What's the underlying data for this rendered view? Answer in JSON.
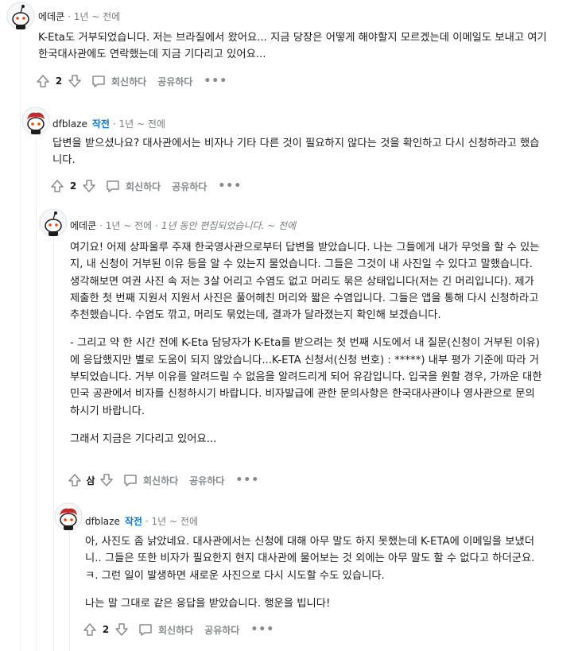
{
  "colors": {
    "op": "#0079d3",
    "meta": "#787c7e",
    "text": "#1c1c1c",
    "action": "#878a8c"
  },
  "labels": {
    "reply": "회신하다",
    "share": "공유하다",
    "more": "•••",
    "op": "작전"
  },
  "comments": [
    {
      "user": "에데쿤",
      "meta": "· 1년 ~ 전에",
      "edited": "",
      "paragraphs": [
        "K-Eta도 거부되었습니다. 저는 브라질에서 왔어요... 지금 당장은 어떻게 해야할지 모르겠는데 이메일도 보내고 여기 한국대사관에도 연락했는데 지금 기다리고 있어요..."
      ],
      "score": "2"
    },
    {
      "user": "dfblaze",
      "meta": "· 1년 ~ 전에",
      "edited": "",
      "paragraphs": [
        "답변을 받으셨나요? 대사관에서는 비자나 기타 다른 것이 필요하지 않다는 것을 확인하고 다시 신청하라고 했습니다."
      ],
      "score": "2"
    },
    {
      "user": "에데쿤",
      "meta": "· 1년 ~ 전에 ·",
      "edited": "1년 동안 편집되었습니다. ~ 전에",
      "paragraphs": [
        "여기요! 어제 상파울루 주재 한국영사관으로부터 답변을 받았습니다. 나는 그들에게 내가 무엇을 할 수 있는지, 내 신청이 거부된 이유 등을 알 수 있는지 물었습니다. 그들은 그것이 내 사진일 수 있다고 말했습니다. 생각해보면 여권 사진 속 저는 3살 어리고 수염도 없고 머리도 묶은 상태입니다(저는 긴 머리입니다). 제가 제출한 첫 번째 지원서 지원서 사진은 풀어헤친 머리와 짧은 수염입니다. 그들은 앱을 통해 다시 신청하라고 추천했습니다. 수염도 깎고, 머리도 묶었는데, 결과가 달라졌는지 확인해 보겠습니다.",
        "- 그리고 약 한 시간 전에 K-Eta 담당자가 K-Eta를 받으려는 첫 번째 시도에서 내 질문(신청이 거부된 이유)에 응답했지만 별로 도움이 되지 않았습니다...K-ETA 신청서(신청 번호) : *****) 내부 평가 기준에 따라 거부되었습니다. 거부 이유를 알려드릴 수 없음을 알려드리게 되어 유감입니다. 입국을 원할 경우, 가까운 대한민국 공관에서 비자를 신청하시기 바랍니다. 비자발급에 관한 문의사항은 한국대사관이나 영사관으로 문의하시기 바랍니다.",
        "그래서 지금은 기다리고 있어요..."
      ],
      "score": "삼"
    },
    {
      "user": "dfblaze",
      "meta": "· 1년 ~ 전에",
      "edited": "",
      "paragraphs": [
        "아, 사진도 좀 낡았네요. 대사관에서는 신청에 대해 아무 말도 하지 못했는데 K-ETA에 이메일을 보냈더니.. 그들은 또한 비자가 필요한지 현지 대사관에 물어보는 것 외에는 아무 말도 할 수 없다고 하더군요. ㅋ. 그런 일이 발생하면 새로운 사진으로 다시 시도할 수도 있습니다.",
        "나는 말 그대로 같은 응답을 받았습니다. 행운을 빕니다!"
      ],
      "score": "2"
    }
  ]
}
